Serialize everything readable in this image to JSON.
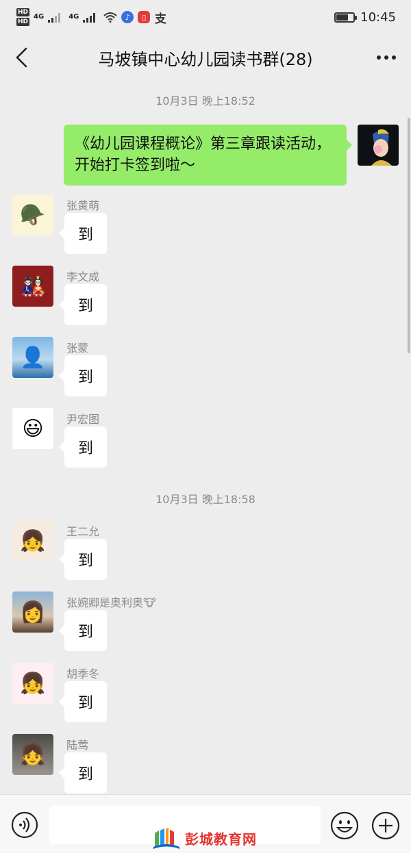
{
  "status_bar": {
    "hd1": "HD",
    "hd2": "HD",
    "net1": "4G",
    "net2": "4G",
    "time": "10:45",
    "battery_level": 0.7,
    "icons": [
      "signal-icon",
      "wifi-icon",
      "music-app-icon",
      "book-app-icon",
      "alipay-icon",
      "battery-icon"
    ]
  },
  "nav": {
    "title": "马坡镇中心幼儿园读书群(28)"
  },
  "chat": {
    "timestamp1": "10月3日 晚上18:52",
    "sent_message": "《幼儿园课程概论》第三章跟读活动，开始打卡签到啦～",
    "timestamp2": "10月3日 晚上18:58",
    "messages": [
      {
        "sender": "张黄萌",
        "text": "到"
      },
      {
        "sender": "李文成",
        "text": "到"
      },
      {
        "sender": "张蒙",
        "text": "到"
      },
      {
        "sender": "尹宏图",
        "text": "到"
      },
      {
        "sender": "王二允",
        "text": "到"
      },
      {
        "sender": "张婉卿是奥利奥🐮",
        "text": "到"
      },
      {
        "sender": "胡季冬",
        "text": "到"
      },
      {
        "sender": "陆莺",
        "text": "到"
      }
    ]
  },
  "watermark": {
    "text": "彭城教育网"
  },
  "colors": {
    "background": "#ededed",
    "sent_bubble": "#95ec69",
    "received_bubble": "#ffffff",
    "watermark": "#e3342f"
  }
}
